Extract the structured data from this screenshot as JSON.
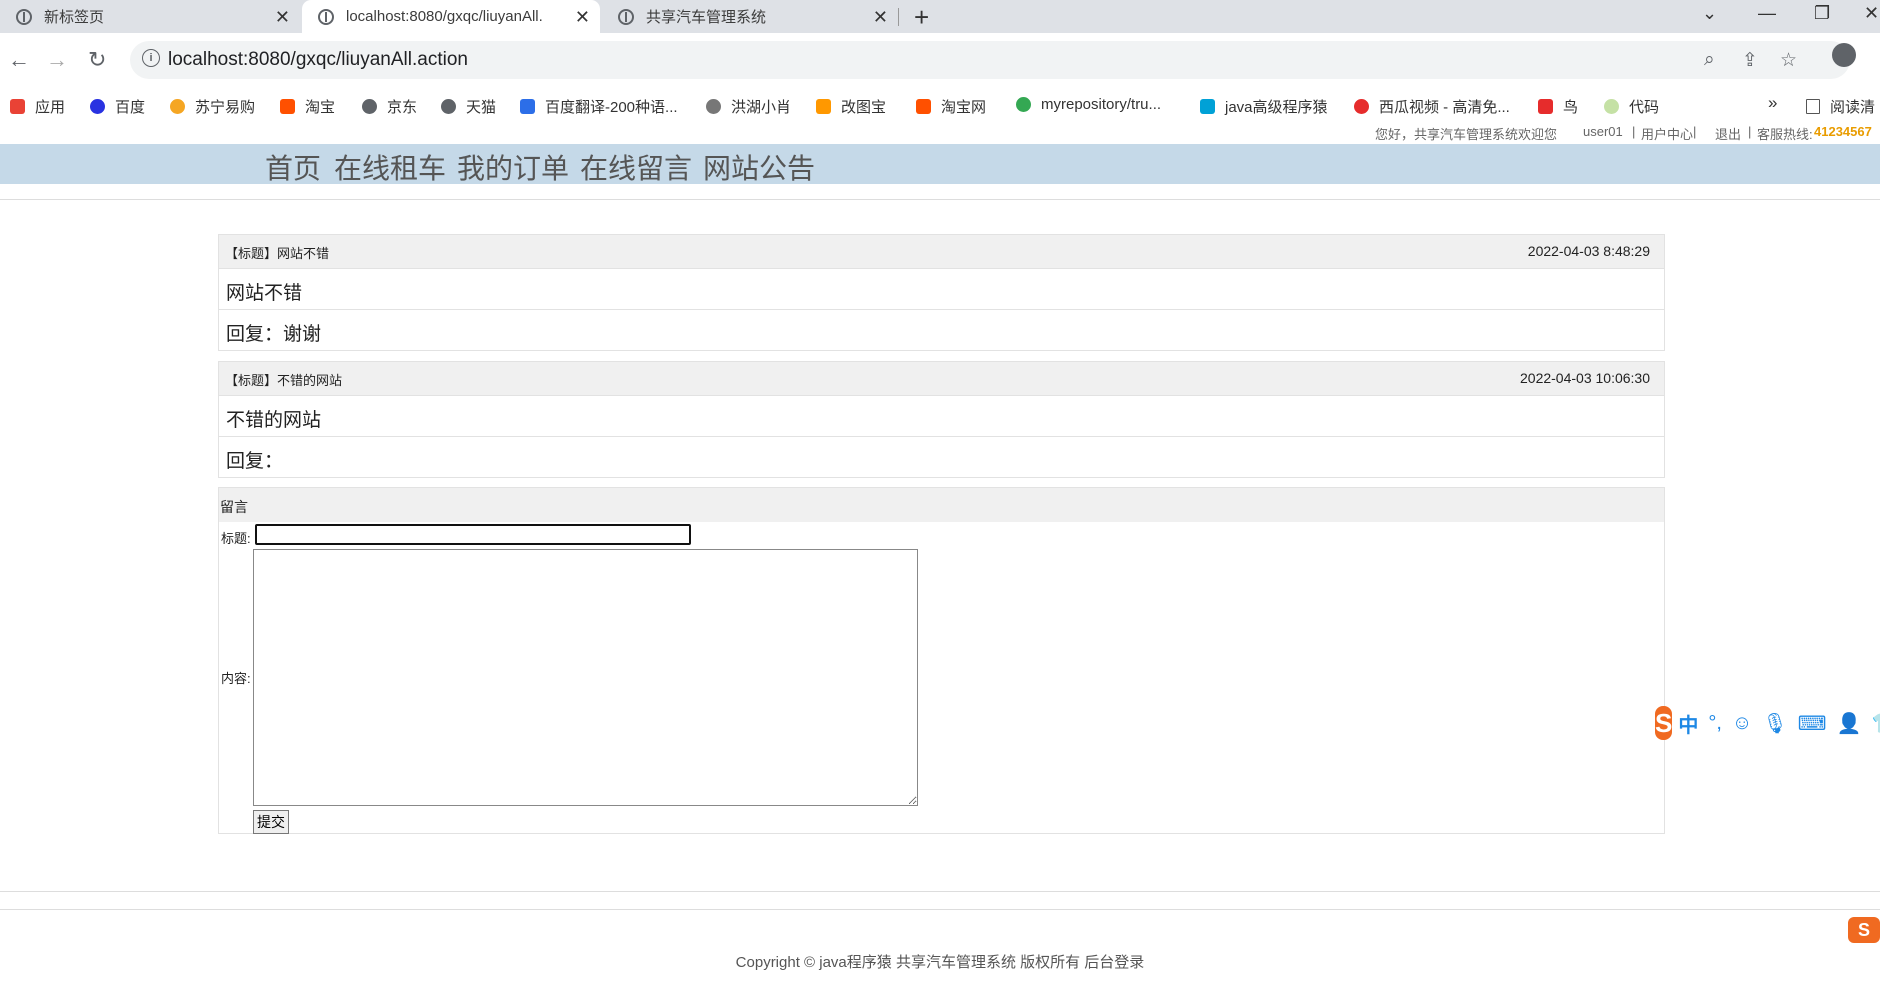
{
  "browser": {
    "tabs": [
      {
        "title": "新标签页",
        "close": "✕"
      },
      {
        "title": "localhost:8080/gxqc/liuyanAll.",
        "close": "✕"
      },
      {
        "title": "共享汽车管理系统",
        "close": "✕"
      }
    ],
    "new_tab": "+",
    "url": "localhost:8080/gxqc/liuyanAll.action",
    "bookmarks": [
      {
        "label": "应用",
        "color": "#e94235"
      },
      {
        "label": "百度",
        "color": "#2932e1"
      },
      {
        "label": "苏宁易购",
        "color": "#f5a623"
      },
      {
        "label": "淘宝",
        "color": "#ff5000"
      },
      {
        "label": "京东",
        "color": "#5f6368"
      },
      {
        "label": "天猫",
        "color": "#5f6368"
      },
      {
        "label": "百度翻译-200种语...",
        "color": "#2c6ee8"
      },
      {
        "label": "洪湖小肖",
        "color": "#777777"
      },
      {
        "label": "改图宝",
        "color": "#ff9800"
      },
      {
        "label": "淘宝网",
        "color": "#ff5000"
      },
      {
        "label": "myrepository/tru...",
        "color": "#34a853"
      },
      {
        "label": "java高级程序猿",
        "color": "#00a1d6"
      },
      {
        "label": "西瓜视频 - 高清免...",
        "color": "#e62c2c"
      },
      {
        "label": "鸟",
        "color": "#e62c2c"
      },
      {
        "label": "代码",
        "color": "#c5e1a5"
      }
    ],
    "bookmarks_more": "»",
    "reading_list": "阅读清"
  },
  "topinfo": {
    "welcome": "您好，共享汽车管理系统欢迎您",
    "user": "user01",
    "user_center": "用户中心",
    "logout": "退出",
    "hotline_label": "客服热线:",
    "hotline": "41234567",
    "sep": "|"
  },
  "nav": [
    "首页",
    "在线租车",
    "我的订单",
    "在线留言",
    "网站公告"
  ],
  "messages": [
    {
      "title": "【标题】网站不错",
      "date": "2022-04-03 8:48:29",
      "content": "网站不错",
      "reply": "回复：谢谢"
    },
    {
      "title": "【标题】不错的网站",
      "date": "2022-04-03 10:06:30",
      "content": "不错的网站",
      "reply": "回复："
    }
  ],
  "form": {
    "heading": "留言",
    "title_label": "标题:",
    "content_label": "内容:",
    "title_value": "",
    "content_value": "",
    "submit": "提交"
  },
  "ime": {
    "logo": "S",
    "lang": "中",
    "punct": "°,"
  },
  "footer": {
    "text": "Copyright © java程序猿 共享汽车管理系统 版权所有",
    "admin_link": "后台登录"
  }
}
